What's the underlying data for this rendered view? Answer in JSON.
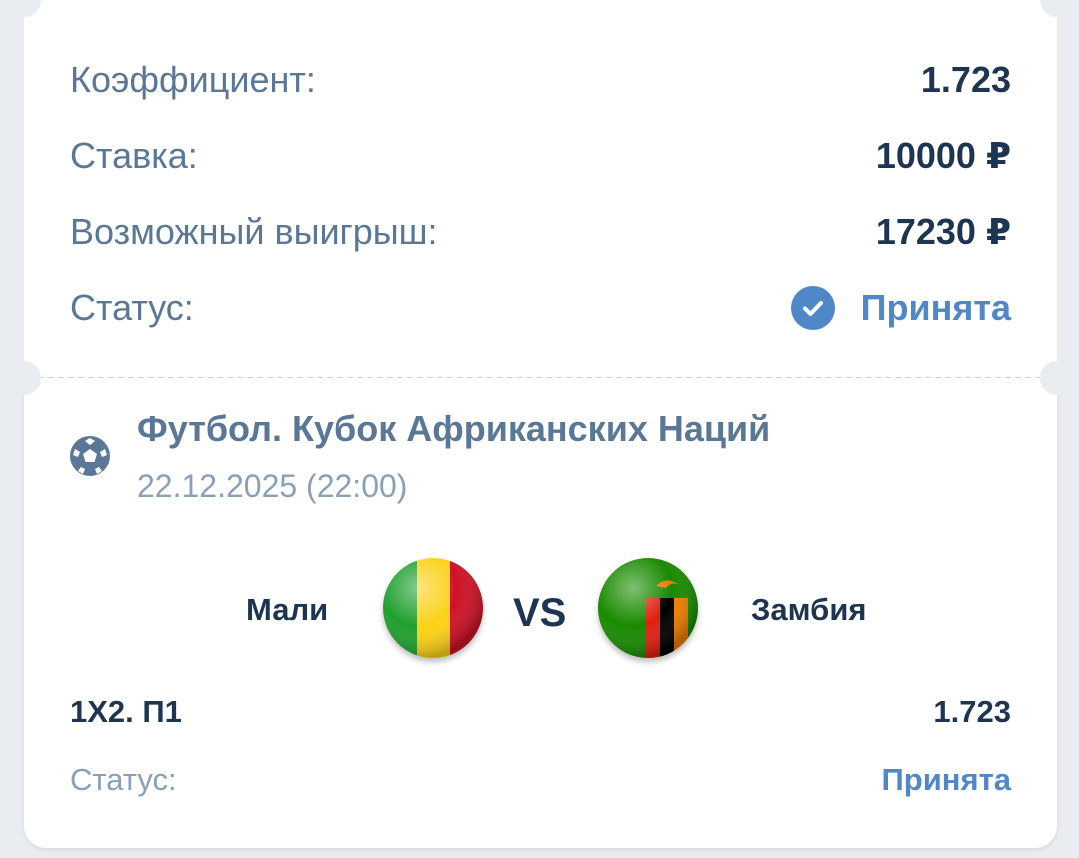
{
  "summary": {
    "coef_label": "Коэффициент:",
    "coef_value": "1.723",
    "stake_label": "Ставка:",
    "stake_value": "10000 ₽",
    "win_label": "Возможный выигрыш:",
    "win_value": "17230 ₽",
    "status_label": "Статус:",
    "status_value": "Принята"
  },
  "event": {
    "sport_icon": "soccer-ball-icon",
    "title": "Футбол. Кубок Африканских Наций",
    "datetime": "22.12.2025 (22:00)",
    "home_team": "Мали",
    "away_team": "Замбия",
    "vs": "VS"
  },
  "bet": {
    "market": "1X2. П1",
    "odds": "1.723",
    "status_label": "Статус:",
    "status_value": "Принята"
  },
  "colors": {
    "label": "#5a7896",
    "value": "#1e3552",
    "accent": "#4f87c7",
    "background": "#e9edf2"
  }
}
